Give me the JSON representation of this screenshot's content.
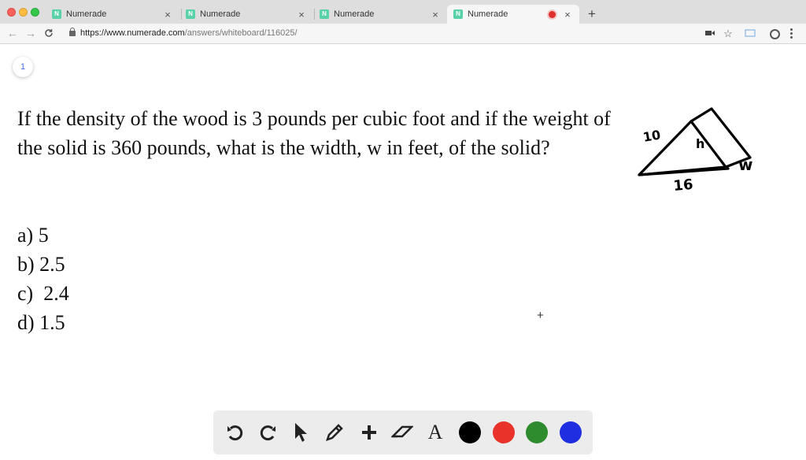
{
  "browser": {
    "tabs": [
      {
        "title": "Numerade",
        "favicon": "N",
        "close": "×",
        "active": false
      },
      {
        "title": "Numerade",
        "favicon": "N",
        "close": "×",
        "active": false
      },
      {
        "title": "Numerade",
        "favicon": "N",
        "close": "×",
        "active": false
      },
      {
        "title": "Numerade",
        "favicon": "N",
        "close": "×",
        "active": true,
        "recording": true
      }
    ],
    "new_tab": "+",
    "url_host": "https://www.numerade.com",
    "url_path": "/answers/whiteboard/116025/",
    "icons": [
      "back-arrow-icon",
      "forward-arrow-icon",
      "reload-icon",
      "lock-icon",
      "camera-icon",
      "star-icon",
      "cast-icon",
      "account-icon",
      "menu-icon"
    ]
  },
  "page": {
    "page_number": "1",
    "question": "If the density of the wood is 3 pounds per cubic foot and if the weight of the solid is 360 pounds, what is the width, w in feet, of the solid?",
    "options": [
      "a) 5",
      "b) 2.5",
      "c)  2.4",
      "d) 1.5"
    ],
    "diagram": {
      "label_hyp": "10",
      "label_h": "h",
      "label_base": "16",
      "label_w": "w"
    }
  },
  "drawbar": {
    "tools": [
      "undo-icon",
      "redo-icon",
      "select-arrow-icon",
      "pencil-icon",
      "plus-icon",
      "eraser-icon",
      "text-icon"
    ],
    "text_tool_label": "A",
    "colors": [
      "#000000",
      "#e8322a",
      "#2e8b2e",
      "#1f2ee0"
    ]
  }
}
